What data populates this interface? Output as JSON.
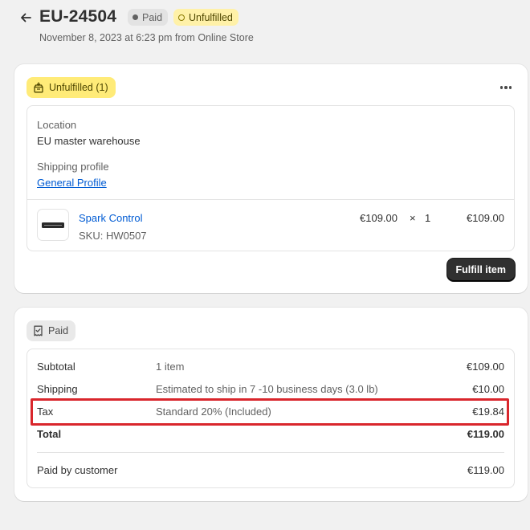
{
  "header": {
    "title": "EU-24504",
    "badges": {
      "paid": "Paid",
      "unfulfilled": "Unfulfilled"
    },
    "subtitle": "November 8, 2023 at 6:23 pm from Online Store"
  },
  "fulfillment_card": {
    "status_label": "Unfulfilled (1)",
    "location_label": "Location",
    "location_value": "EU master warehouse",
    "shipping_profile_label": "Shipping profile",
    "shipping_profile_value": "General Profile",
    "item": {
      "name": "Spark Control",
      "sku": "SKU: HW0507",
      "unit_price": "€109.00",
      "times": "×",
      "quantity": "1",
      "total": "€109.00"
    },
    "fulfill_button": "Fulfill item"
  },
  "payment_card": {
    "status_label": "Paid",
    "rows": [
      {
        "label": "Subtotal",
        "detail": "1 item",
        "amount": "€109.00"
      },
      {
        "label": "Shipping",
        "detail": "Estimated to ship in 7 -10 business days (3.0 lb)",
        "amount": "€10.00"
      },
      {
        "label": "Tax",
        "detail": "Standard 20% (Included)",
        "amount": "€19.84"
      },
      {
        "label": "Total",
        "detail": "",
        "amount": "€119.00"
      }
    ],
    "paid_by_customer": {
      "label": "Paid by customer",
      "amount": "€119.00"
    }
  },
  "colors": {
    "background": "#f1f1f1",
    "link": "#005bd3",
    "unfulfilled_badge": "#fff1a8",
    "unfulfilled_pill": "#ffeb78",
    "highlight": "#d9262c"
  }
}
